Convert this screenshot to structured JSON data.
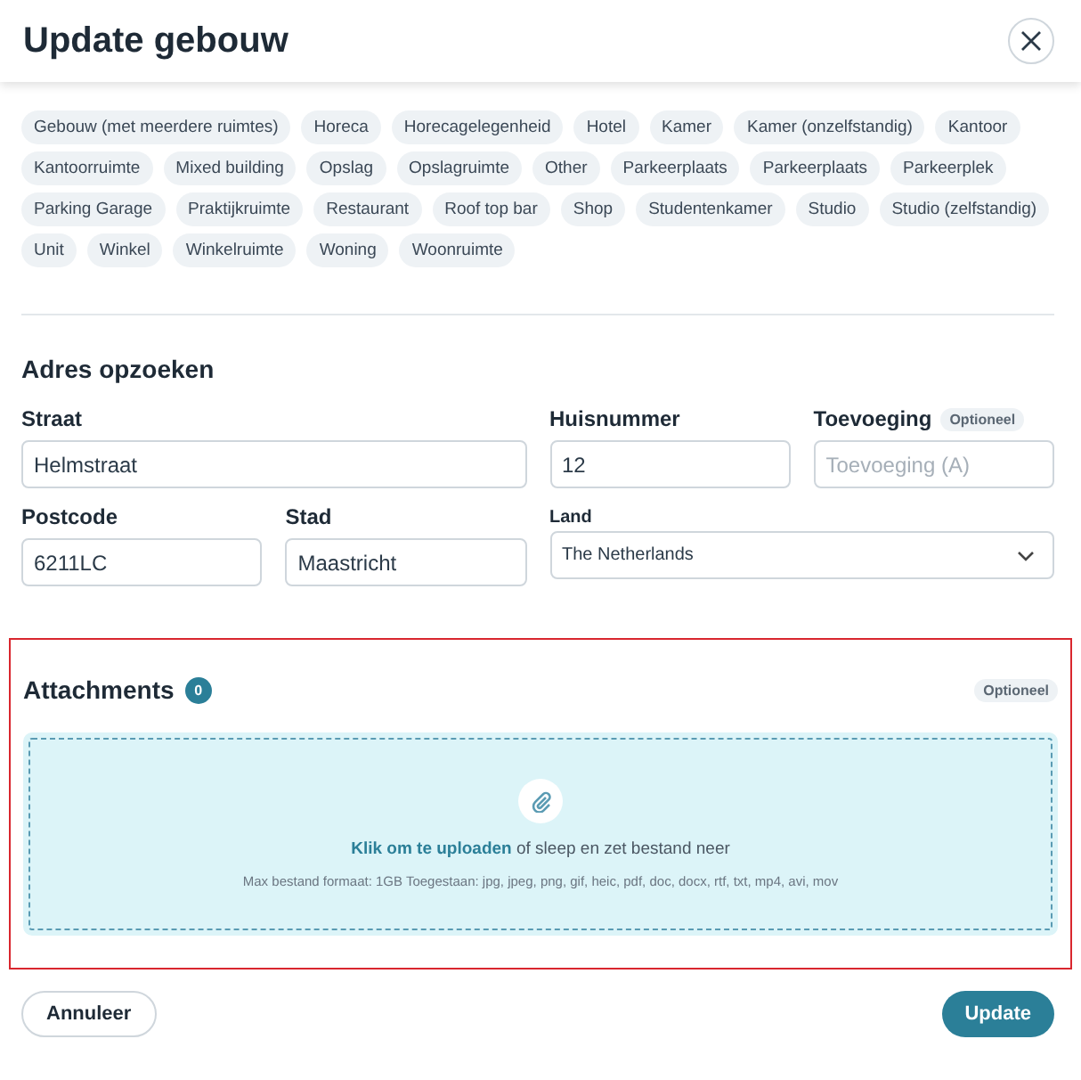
{
  "window": {
    "title": "Update gebouw"
  },
  "tags": [
    "Gebouw (met meerdere ruimtes)",
    "Horeca",
    "Horecagelegenheid",
    "Hotel",
    "Kamer",
    "Kamer (onzelfstandig)",
    "Kantoor",
    "Kantoorruimte",
    "Mixed building",
    "Opslag",
    "Opslagruimte",
    "Other",
    "Parkeerplaats",
    "Parkeerplaats",
    "Parkeerplek",
    "Parking Garage",
    "Praktijkruimte",
    "Restaurant",
    "Roof top bar",
    "Shop",
    "Studentenkamer",
    "Studio",
    "Studio (zelfstandig)",
    "Unit",
    "Winkel",
    "Winkelruimte",
    "Woning",
    "Woonruimte"
  ],
  "address": {
    "title": "Adres opzoeken",
    "fields": [
      {
        "kind": "text",
        "label": "Straat",
        "value": "Helmstraat"
      },
      {
        "kind": "text",
        "label": "Huisnummer",
        "value": "12"
      },
      {
        "kind": "text",
        "label": "Toevoeging",
        "badge": "Optioneel",
        "placeholder": "Toevoeging (A)"
      },
      {
        "kind": "text",
        "label": "Postcode",
        "value": "6211LC"
      },
      {
        "kind": "text",
        "label": "Stad",
        "value": "Maastricht"
      },
      {
        "kind": "select",
        "label": "Land",
        "value": "The Netherlands"
      }
    ]
  },
  "attachments": {
    "title": "Attachments",
    "count": "0",
    "badge": "Optioneel",
    "highlighted": true,
    "link": "Klik om te uploaden",
    "text": " of sleep en zet bestand neer",
    "info": "Max bestand formaat: 1GB Toegestaan: jpg, jpeg, png, gif, heic, pdf, doc, docx, rtf, txt, mp4, avi, mov"
  },
  "buttons": {
    "cancel": "Annuleer",
    "submit": "Update"
  }
}
